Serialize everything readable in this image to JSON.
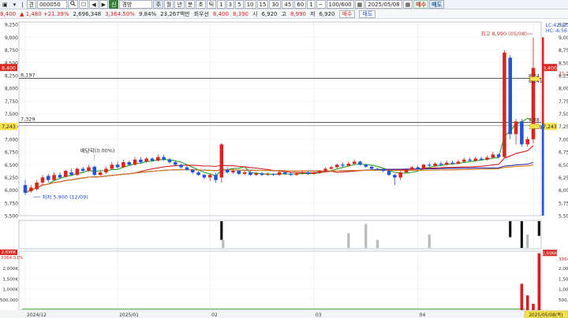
{
  "toolbar": {
    "icon_left": "▣",
    "menu_label": "▾",
    "sep1": "|",
    "kind_label": "견",
    "code_value": "000050",
    "search_icon": "search-icon",
    "lock_label": "☐",
    "prev_label": "◀",
    "next_label": "▶",
    "badge": "신",
    "stock_name": "경방",
    "period_buttons": [
      "주",
      "월",
      "년",
      "분",
      "초",
      "틱"
    ],
    "interval_buttons": [
      "1",
      "3",
      "5",
      "10",
      "15",
      "30",
      "45",
      "60",
      "1"
    ],
    "minus_label": "−",
    "count_value": "100/600",
    "calendar_label": "▦",
    "date_value": "2025/05/08",
    "cal_icon": "▦",
    "buy_label": "매수",
    "sell_label": "매도"
  },
  "info": {
    "price": "8,400",
    "change": "▲ 1,480 +21.39%",
    "volume": "2,696,348",
    "volume_ratio": "3,364.50%",
    "turnover": "9.84%",
    "amount": "23,267백만",
    "rotation_label": "회우선",
    "bid": "8,400",
    "ask": "8,390",
    "open_label": "시",
    "open_value": "6,920",
    "high_label": "고",
    "high_value": "8,990",
    "low_label": "저",
    "low_value": "6,920"
  },
  "chart_data": {
    "type": "candlestick",
    "price_axis": {
      "min": 5500,
      "max": 9300,
      "ticks": [
        "9,250",
        "9,000",
        "8,750",
        "8,500",
        "8,250",
        "8,000",
        "7,750",
        "7,500",
        "7,250",
        "7,000",
        "6,750",
        "6,500",
        "6,250",
        "6,000",
        "5,750",
        "5,500"
      ],
      "tick_values": [
        9250,
        9000,
        8750,
        8500,
        8250,
        8000,
        7750,
        7500,
        7250,
        7000,
        6750,
        6500,
        6250,
        6000,
        5750,
        5500
      ]
    },
    "x_labels": [
      {
        "text": "2024/12",
        "index": 0
      },
      {
        "text": "2025/01",
        "index": 16
      },
      {
        "text": "02",
        "index": 32
      },
      {
        "text": "03",
        "index": 50
      },
      {
        "text": "04",
        "index": 68
      },
      {
        "text": "05",
        "index": 88
      }
    ],
    "current_price": {
      "text": "8,400",
      "value": 8400
    },
    "current_pct": "21.39%",
    "hline_upper": {
      "text": "8,197",
      "value": 8197
    },
    "hline_lower": {
      "text": "7,329",
      "value": 7329
    },
    "alt_price": {
      "text": "7,243",
      "value": 7243
    },
    "right_tag_1": {
      "text": "8,24",
      "value": 8240
    },
    "right_tag_2": {
      "text": "8,141",
      "value": 8141
    },
    "right_tag_3": {
      "text": "7,38",
      "value": 7380
    },
    "right_tag_4": {
      "text": "7,229",
      "value": 7229
    },
    "lc_label": "LC:42.37",
    "hc_label": "HC:-6.56",
    "high_annotation": "최고 8,990 (05/08)",
    "low_annotation": "최저 5,900 (12/09)",
    "dividend_annotation": "배당락(0.00%)",
    "candles": [
      [
        6100,
        5950,
        6200,
        5900
      ],
      [
        5980,
        6050,
        6100,
        5950
      ],
      [
        6020,
        6150,
        6200,
        6000
      ],
      [
        6150,
        6250,
        6300,
        6100
      ],
      [
        6280,
        6200,
        6320,
        6150
      ],
      [
        6200,
        6300,
        6350,
        6180
      ],
      [
        6300,
        6250,
        6350,
        6220
      ],
      [
        6260,
        6380,
        6400,
        6240
      ],
      [
        6350,
        6300,
        6420,
        6280
      ],
      [
        6300,
        6420,
        6450,
        6280
      ],
      [
        6420,
        6380,
        6460,
        6350
      ],
      [
        6380,
        6450,
        6500,
        6360
      ],
      [
        6460,
        6300,
        6480,
        6280
      ],
      [
        6300,
        6350,
        6400,
        6280
      ],
      [
        6350,
        6420,
        6460,
        6320
      ],
      [
        6420,
        6500,
        6550,
        6400
      ],
      [
        6500,
        6450,
        6560,
        6420
      ],
      [
        6450,
        6550,
        6600,
        6430
      ],
      [
        6550,
        6500,
        6580,
        6480
      ],
      [
        6500,
        6600,
        6650,
        6480
      ],
      [
        6600,
        6550,
        6650,
        6520
      ],
      [
        6560,
        6620,
        6650,
        6540
      ],
      [
        6620,
        6580,
        6650,
        6560
      ],
      [
        6580,
        6650,
        6700,
        6560
      ],
      [
        6650,
        6600,
        6700,
        6580
      ],
      [
        6600,
        6550,
        6630,
        6520
      ],
      [
        6550,
        6500,
        6580,
        6480
      ],
      [
        6500,
        6450,
        6520,
        6420
      ],
      [
        6450,
        6400,
        6480,
        6380
      ],
      [
        6400,
        6350,
        6420,
        6320
      ],
      [
        6350,
        6300,
        6380,
        6280
      ],
      [
        6300,
        6250,
        6320,
        6220
      ],
      [
        6250,
        6300,
        6320,
        6180
      ],
      [
        6300,
        6200,
        6340,
        6150
      ],
      [
        6250,
        6900,
        6920,
        6150
      ],
      [
        6400,
        6350,
        6450,
        6320
      ],
      [
        6350,
        6380,
        6420,
        6320
      ],
      [
        6380,
        6320,
        6400,
        6300
      ],
      [
        6320,
        6350,
        6380,
        6300
      ],
      [
        6350,
        6300,
        6380,
        6280
      ],
      [
        6300,
        6330,
        6360,
        6280
      ],
      [
        6330,
        6300,
        6360,
        6280
      ],
      [
        6300,
        6320,
        6350,
        6280
      ],
      [
        6320,
        6300,
        6340,
        6280
      ],
      [
        6300,
        6350,
        6380,
        6280
      ],
      [
        6350,
        6320,
        6370,
        6300
      ],
      [
        6320,
        6300,
        6350,
        6280
      ],
      [
        6300,
        6330,
        6350,
        6280
      ],
      [
        6330,
        6350,
        6380,
        6310
      ],
      [
        6350,
        6320,
        6370,
        6300
      ],
      [
        6320,
        6340,
        6360,
        6300
      ],
      [
        6340,
        6380,
        6400,
        6320
      ],
      [
        6380,
        6420,
        6450,
        6360
      ],
      [
        6420,
        6450,
        6480,
        6400
      ],
      [
        6450,
        6500,
        6520,
        6430
      ],
      [
        6500,
        6480,
        6540,
        6450
      ],
      [
        6480,
        6520,
        6560,
        6460
      ],
      [
        6520,
        6560,
        6600,
        6500
      ],
      [
        6560,
        6500,
        6580,
        6480
      ],
      [
        6500,
        6460,
        6520,
        6440
      ],
      [
        6460,
        6420,
        6480,
        6400
      ],
      [
        6420,
        6400,
        6440,
        6380
      ],
      [
        6400,
        6380,
        6420,
        6350
      ],
      [
        6380,
        6300,
        6400,
        6280
      ],
      [
        6300,
        6250,
        6320,
        6100
      ],
      [
        6250,
        6350,
        6380,
        6200
      ],
      [
        6350,
        6400,
        6420,
        6320
      ],
      [
        6400,
        6450,
        6480,
        6380
      ],
      [
        6450,
        6420,
        6480,
        6400
      ],
      [
        6420,
        6500,
        6520,
        6400
      ],
      [
        6500,
        6480,
        6540,
        6460
      ],
      [
        6480,
        6520,
        6550,
        6460
      ],
      [
        6520,
        6500,
        6560,
        6480
      ],
      [
        6500,
        6540,
        6580,
        6480
      ],
      [
        6540,
        6520,
        6580,
        6500
      ],
      [
        6520,
        6560,
        6600,
        6500
      ],
      [
        6560,
        6600,
        6640,
        6540
      ],
      [
        6600,
        6580,
        6640,
        6560
      ],
      [
        6580,
        6620,
        6660,
        6560
      ],
      [
        6620,
        6600,
        6660,
        6580
      ],
      [
        6600,
        6640,
        6680,
        6580
      ],
      [
        6640,
        6700,
        6750,
        6620
      ],
      [
        6700,
        6650,
        6720,
        6620
      ],
      [
        6650,
        8700,
        8750,
        6640
      ],
      [
        8600,
        7100,
        8650,
        7000
      ],
      [
        7100,
        7350,
        7400,
        6900
      ],
      [
        7350,
        6900,
        7400,
        6850
      ],
      [
        6900,
        7000,
        7050,
        6850
      ],
      [
        7000,
        8400,
        8990,
        6920
      ]
    ],
    "ma_lines": [
      {
        "name": "ma5",
        "color": "#21a321"
      },
      {
        "name": "ma20",
        "color": "#d21f1f"
      },
      {
        "name": "ma60",
        "color": "#2a2aa8"
      },
      {
        "name": "ma120",
        "color": "#d97a16"
      }
    ],
    "indicator_panel": {
      "bars": [
        {
          "index": 34,
          "h": 0.7,
          "color": "#111"
        },
        {
          "index": 34,
          "h": 0.3,
          "color": "#bbb",
          "offset": 2
        },
        {
          "index": 56,
          "h": 0.55,
          "color": "#bbb"
        },
        {
          "index": 59,
          "h": 0.9,
          "color": "#bbb"
        },
        {
          "index": 61,
          "h": 0.3,
          "color": "#bbb"
        },
        {
          "index": 70,
          "h": 0.5,
          "color": "#bbb"
        },
        {
          "index": 84,
          "h": 0.6,
          "color": "#111"
        },
        {
          "index": 86,
          "h": 1.0,
          "color": "#111"
        },
        {
          "index": 87,
          "h": 0.5,
          "color": "#bbb"
        },
        {
          "index": 89,
          "h": 0.55,
          "color": "#111"
        }
      ]
    },
    "volume_axis": {
      "ticks": [
        "2,000K",
        "1,500K",
        "1,000K",
        "500,000"
      ],
      "tick_values": [
        2000000,
        1500000,
        1000000,
        500000
      ],
      "max": 2800000,
      "top_label": "2,696K",
      "top_pct": "3364.51%"
    },
    "volume_top_left": "3364.51%",
    "volume_bars": [
      {
        "index": 86,
        "value": 1250000,
        "color": "#d21f1f"
      },
      {
        "index": 87,
        "value": 700000,
        "color": "#d21f1f"
      },
      {
        "index": 88,
        "value": 300000,
        "color": "#d21f1f"
      },
      {
        "index": 89,
        "value": 2696348,
        "color": "#d21f1f"
      }
    ],
    "date_bottom_label": "2025/05/08(목)"
  }
}
